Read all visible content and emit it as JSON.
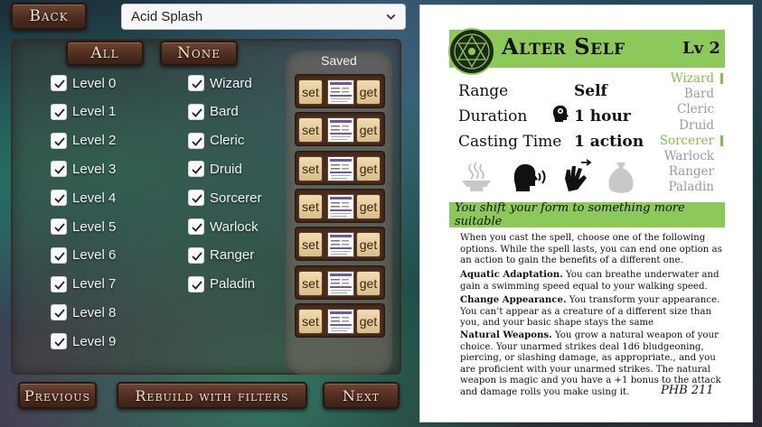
{
  "header": {
    "back_label": "Back",
    "spell_select_value": "Acid Splash"
  },
  "filters": {
    "all_label": "All",
    "none_label": "None",
    "levels": [
      "Level 0",
      "Level 1",
      "Level 2",
      "Level 3",
      "Level 4",
      "Level 5",
      "Level 6",
      "Level 7",
      "Level 8",
      "Level 9"
    ],
    "classes": [
      "Wizard",
      "Bard",
      "Cleric",
      "Druid",
      "Sorcerer",
      "Warlock",
      "Ranger",
      "Paladin"
    ]
  },
  "saved": {
    "title": "Saved",
    "set_label": "set",
    "get_label": "get",
    "slots": 7
  },
  "footer": {
    "previous_label": "Previous",
    "rebuild_label": "Rebuild with filters",
    "next_label": "Next"
  },
  "card": {
    "name": "Alter Self",
    "level": "Lv 2",
    "range_label": "Range",
    "range_value": "Self",
    "duration_label": "Duration",
    "duration_value": "1 hour",
    "casting_label": "Casting Time",
    "casting_value": "1 action",
    "classes": [
      {
        "name": "Wizard",
        "active": true
      },
      {
        "name": "Bard",
        "active": false
      },
      {
        "name": "Cleric",
        "active": false
      },
      {
        "name": "Druid",
        "active": false
      },
      {
        "name": "Sorcerer",
        "active": true
      },
      {
        "name": "Warlock",
        "active": false
      },
      {
        "name": "Ranger",
        "active": false
      },
      {
        "name": "Paladin",
        "active": false
      }
    ],
    "tagline": "You shift your form to something more suitable",
    "intro": "When you cast the spell, choose one of the following options. While the spell lasts, you can end one option as an action to gain the benefits of a different one.",
    "opt1_title": "Aquatic Adaptation.",
    "opt1_text": " You can breathe underwater and gain a swimming speed equal to your walking speed.",
    "opt2_title": "Change Appearance.",
    "opt2_text": " You transform your appearance. You can’t appear as a creature of a different size than you, and your basic shape stays the same",
    "opt3_title": "Natural Weapons.",
    "opt3_text": " You grow a natural weapon of your choice. Your unarmed strikes deal 1d6 bludgeoning, piercing, or slashing damage, as appropriate., and you are proficient with your unarmed strikes. The natural weapon is magic and you have a +1 bonus to the attack and damage rolls you make using it.",
    "source": "PHB 211",
    "accent_color": "#8dc95a",
    "component_icons": [
      "ritual-icon",
      "verbal-icon",
      "somatic-icon",
      "material-icon"
    ]
  }
}
